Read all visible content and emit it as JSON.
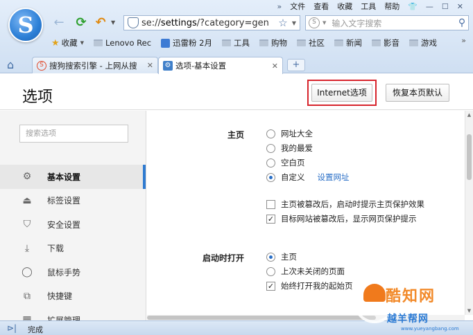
{
  "menubar": [
    "»",
    "文件",
    "查看",
    "收藏",
    "工具",
    "帮助"
  ],
  "toolbar": {
    "address_prefix": "se://",
    "address_main": "settings",
    "address_rest": "/?category=gen",
    "search_placeholder": "输入文字搜索"
  },
  "bookmarks": {
    "favorites": "收藏",
    "items": [
      "Lenovo Rec",
      "迅雷粉 2月",
      "工具",
      "购物",
      "社区",
      "新闻",
      "影音",
      "游戏"
    ],
    "more": "»"
  },
  "tabs": [
    {
      "label": "搜狗搜索引擎 - 上网从搜",
      "icon": "sogou-search-icon"
    },
    {
      "label": "选项-基本设置",
      "icon": "settings-icon",
      "active": true
    }
  ],
  "new_tab_label": "+",
  "page": {
    "title": "选项",
    "internet_options": "Internet选项",
    "restore_defaults": "恢复本页默认"
  },
  "sidebar": {
    "search_placeholder": "搜索选项",
    "items": [
      {
        "label": "基本设置",
        "icon": "gear-icon",
        "active": true
      },
      {
        "label": "标签设置",
        "icon": "tab-icon"
      },
      {
        "label": "安全设置",
        "icon": "shield-icon"
      },
      {
        "label": "下载",
        "icon": "download-icon"
      },
      {
        "label": "鼠标手势",
        "icon": "mouse-icon"
      },
      {
        "label": "快捷键",
        "icon": "shortcut-icon"
      },
      {
        "label": "扩展管理",
        "icon": "extension-icon"
      }
    ]
  },
  "content": {
    "homepage": {
      "label": "主页",
      "options": [
        "网址大全",
        "我的最爱",
        "空白页",
        "自定义"
      ],
      "selected": 3,
      "set_link": "设置网址",
      "checks": [
        {
          "label": "主页被篡改后，启动时提示主页保护效果",
          "checked": false
        },
        {
          "label": "目标网站被篡改后，显示网页保护提示",
          "checked": true
        }
      ]
    },
    "startup": {
      "label": "启动时打开",
      "options": [
        "主页",
        "上次未关闭的页面"
      ],
      "selected": 0,
      "check": {
        "label": "始终打开我的起始页",
        "checked": true
      }
    }
  },
  "status": {
    "text": "完成"
  },
  "watermark": {
    "name": "酷知网",
    "sub": "越羊帮网",
    "url": "www.yueyangbang.com"
  },
  "colors": {
    "accent": "#2f7bd1",
    "highlight_box": "#d7232b",
    "link": "#2a6fc7"
  }
}
